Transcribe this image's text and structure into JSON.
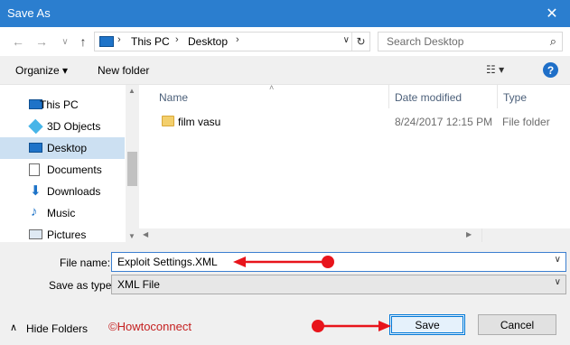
{
  "window": {
    "title": "Save As"
  },
  "address": {
    "crumbs": [
      "This PC",
      "Desktop"
    ]
  },
  "search": {
    "placeholder": "Search Desktop"
  },
  "toolbar": {
    "organize_label": "Organize ▾",
    "new_folder_label": "New folder"
  },
  "nav": {
    "items": [
      {
        "label": "This PC",
        "icon": "computer-icon"
      },
      {
        "label": "3D Objects",
        "icon": "cube-icon"
      },
      {
        "label": "Desktop",
        "icon": "desktop-icon",
        "selected": true
      },
      {
        "label": "Documents",
        "icon": "document-icon"
      },
      {
        "label": "Downloads",
        "icon": "download-icon"
      },
      {
        "label": "Music",
        "icon": "music-icon"
      },
      {
        "label": "Pictures",
        "icon": "picture-icon"
      }
    ]
  },
  "files": {
    "columns": [
      "Name",
      "Date modified",
      "Type"
    ],
    "rows": [
      {
        "name": "film vasu",
        "date": "8/24/2017 12:15 PM",
        "type": "File folder"
      }
    ]
  },
  "form": {
    "file_name_label": "File name:",
    "file_name_value": "Exploit Settings.XML",
    "save_type_label": "Save as type:",
    "save_type_value": "XML File"
  },
  "footer": {
    "hide_folders_label": "Hide Folders",
    "save_label": "Save",
    "cancel_label": "Cancel",
    "watermark": "©Howtoconnect"
  },
  "colors": {
    "titlebar": "#2b7ecf",
    "selection": "#cce0f2",
    "annotation": "#e8141b"
  }
}
